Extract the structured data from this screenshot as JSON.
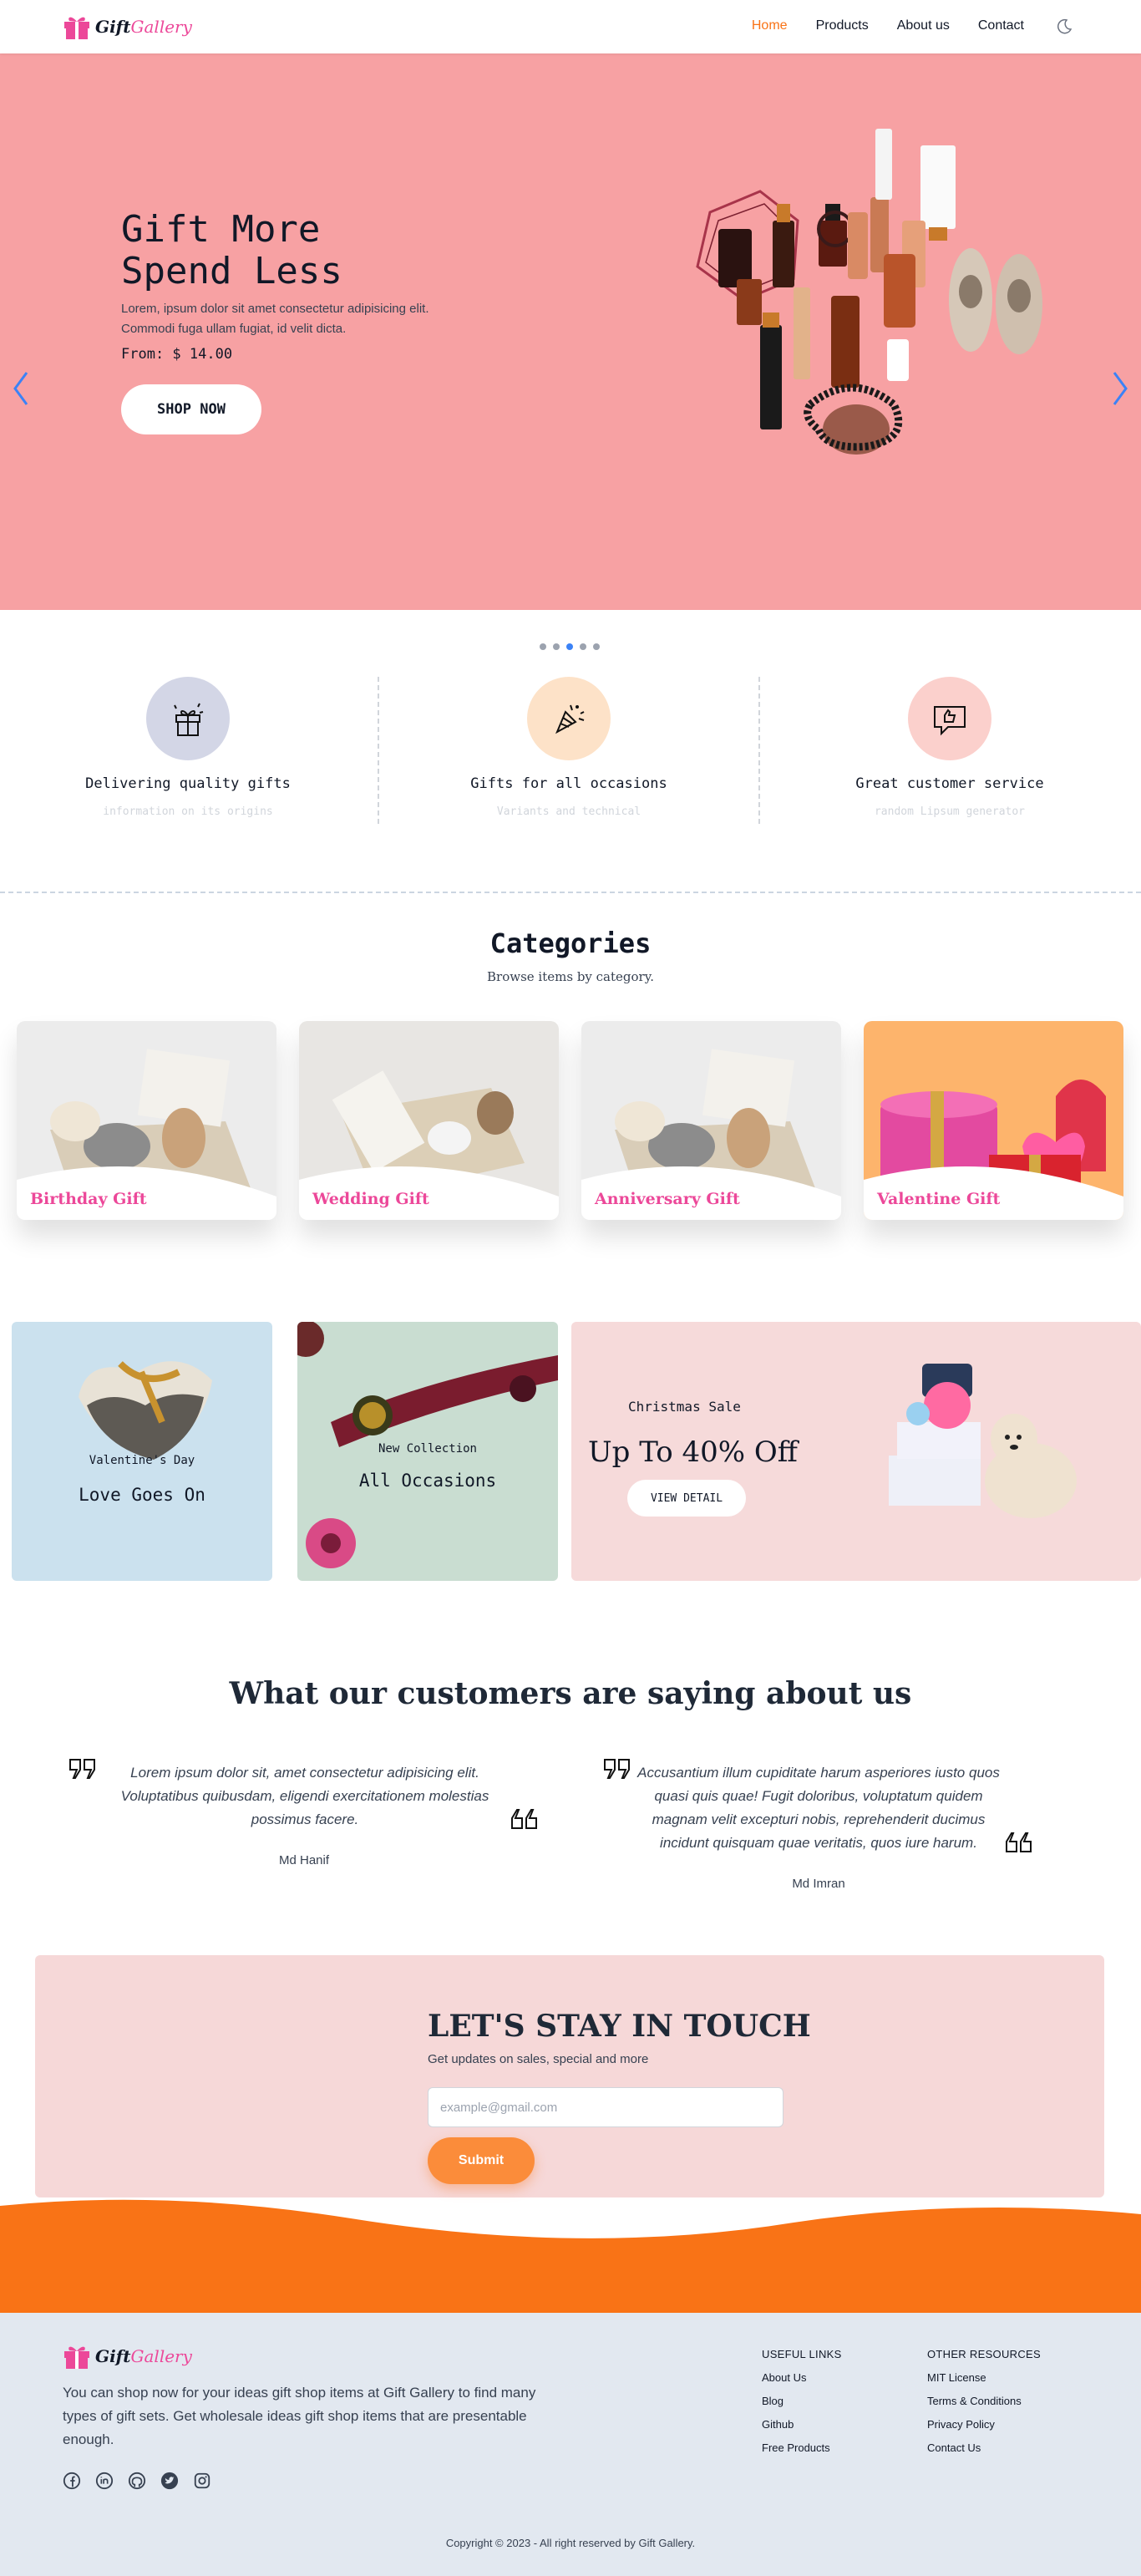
{
  "nav": {
    "logo_gift": "Gift",
    "logo_gallery": "Gallery",
    "links": [
      "Home",
      "Products",
      "About us",
      "Contact"
    ],
    "active_link": "Home",
    "theme_icon": "moon-icon"
  },
  "hero": {
    "title_line1": "Gift More",
    "title_line2": "Spend Less",
    "desc_line1": "Lorem, ipsum dolor sit amet consectetur adipisicing elit.",
    "desc_line2": "Commodi fuga ullam fugiat, id velit dicta.",
    "price": "From: $ 14.00",
    "cta": "SHOP NOW",
    "bg_color": "#f7a1a3",
    "slides": 5,
    "active_slide": 3
  },
  "features": [
    {
      "title": "Delivering quality gifts",
      "subtitle": "information on its origins",
      "icon": "gift-box-icon",
      "blob_color": "#d1d5e6"
    },
    {
      "title": "Gifts for all occasions",
      "subtitle": "Variants and technical",
      "icon": "party-popper-icon",
      "blob_color": "#fde2c8"
    },
    {
      "title": "Great customer service",
      "subtitle": "random Lipsum generator",
      "icon": "chat-thumbs-up-icon",
      "blob_color": "#fbd0cc"
    }
  ],
  "categories": {
    "title": "Categories",
    "subtitle": "Browse items by category.",
    "items": [
      "Birthday Gift",
      "Wedding Gift",
      "Anniversary Gift",
      "Valentine Gift"
    ]
  },
  "promos": {
    "valentine": {
      "tag": "Valentine's Day",
      "name": "Love Goes On"
    },
    "collection": {
      "tag": "New Collection",
      "name": "All Occasions"
    },
    "christmas": {
      "tag": "Christmas Sale",
      "offer": "Up To 40% Off",
      "cta": "VIEW DETAIL"
    }
  },
  "testimonials": {
    "title": "What our customers are saying about us",
    "items": [
      {
        "text": "Lorem ipsum dolor sit, amet consectetur adipisicing elit. Voluptatibus quibusdam, eligendi exercitationem molestias possimus facere.",
        "author": "Md Hanif"
      },
      {
        "text": "Accusantium illum cupiditate harum asperiores iusto quos quasi quis quae! Fugit doloribus, voluptatum quidem magnam velit excepturi nobis, reprehenderit ducimus incidunt quisquam quae veritatis, quos iure harum.",
        "author": "Md Imran"
      }
    ]
  },
  "newsletter": {
    "title": "LET'S STAY IN TOUCH",
    "subtitle": "Get updates on sales, special and more",
    "placeholder": "example@gmail.com",
    "submit": "Submit"
  },
  "footer": {
    "description": "You can shop now for your ideas gift shop items at Gift Gallery to find many types of gift sets. Get wholesale ideas gift shop items that are presentable enough.",
    "useful_links_title": "USEFUL LINKS",
    "useful_links": [
      "About Us",
      "Blog",
      "Github",
      "Free Products"
    ],
    "other_resources_title": "OTHER RESOURCES",
    "other_resources": [
      "MIT License",
      "Terms & Conditions",
      "Privacy Policy",
      "Contact Us"
    ],
    "social_icons": [
      "facebook-icon",
      "linkedin-icon",
      "github-icon",
      "twitter-icon",
      "instagram-icon"
    ],
    "copyright": "Copyright © 2023 - All right reserved by Gift Gallery."
  }
}
